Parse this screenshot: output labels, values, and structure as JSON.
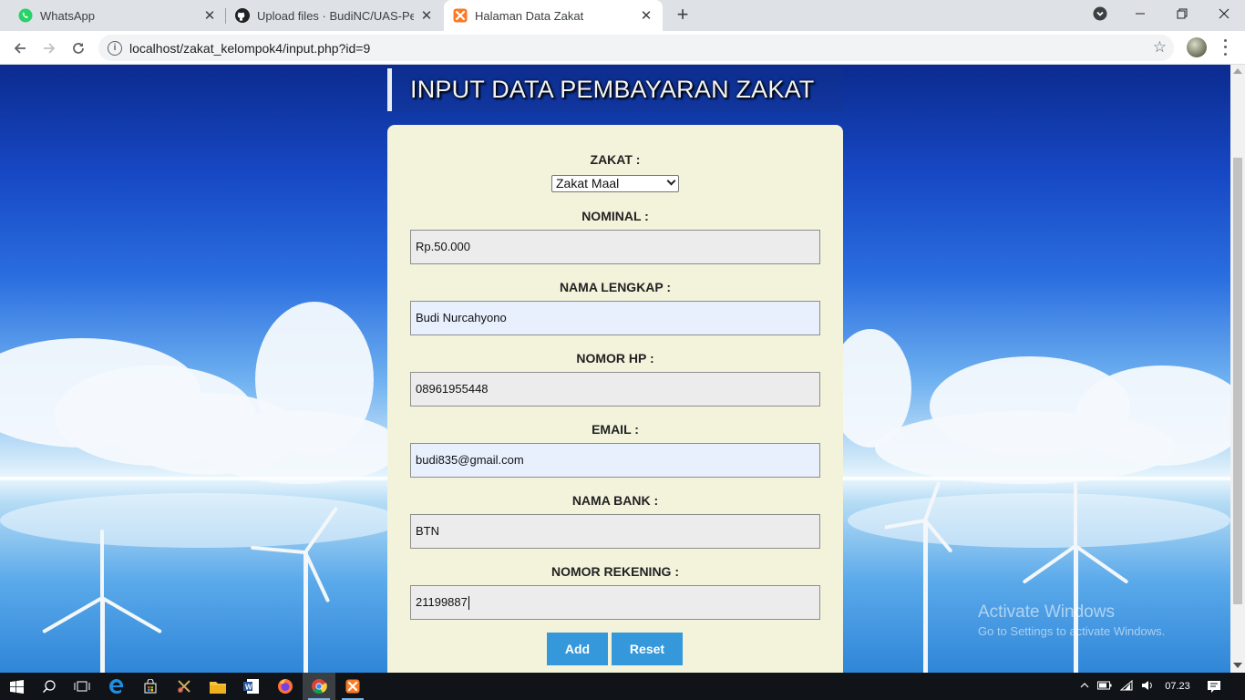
{
  "browser": {
    "tabs": [
      {
        "title": "WhatsApp",
        "icon": "whatsapp-icon",
        "active": false
      },
      {
        "title": "Upload files · BudiNC/UAS-Pemrograman",
        "icon": "github-icon",
        "active": false
      },
      {
        "title": "Halaman Data Zakat",
        "icon": "xampp-icon",
        "active": true
      }
    ],
    "url": "localhost/zakat_kelompok4/input.php?id=9"
  },
  "page": {
    "title": "INPUT DATA PEMBAYARAN ZAKAT",
    "form": {
      "zakat": {
        "label": "ZAKAT :",
        "selected": "Zakat Maal"
      },
      "nominal": {
        "label": "NOMINAL :",
        "value": "Rp.50.000"
      },
      "nama_lengkap": {
        "label": "NAMA LENGKAP :",
        "value": "Budi Nurcahyono"
      },
      "nomor_hp": {
        "label": "NOMOR HP :",
        "value": "08961955448"
      },
      "email": {
        "label": "EMAIL :",
        "value": "budi835@gmail.com"
      },
      "nama_bank": {
        "label": "NAMA BANK :",
        "value": "BTN"
      },
      "nomor_rekening": {
        "label": "NOMOR REKENING :",
        "value": "21199887"
      },
      "add_label": "Add",
      "reset_label": "Reset"
    }
  },
  "watermark": {
    "line1": "Activate Windows",
    "line2": "Go to Settings to activate Windows."
  },
  "taskbar": {
    "clock": "07.23"
  },
  "colors": {
    "form_bg": "#f3f3dc",
    "button": "#3498db",
    "autofill": "#e8f0fe"
  }
}
